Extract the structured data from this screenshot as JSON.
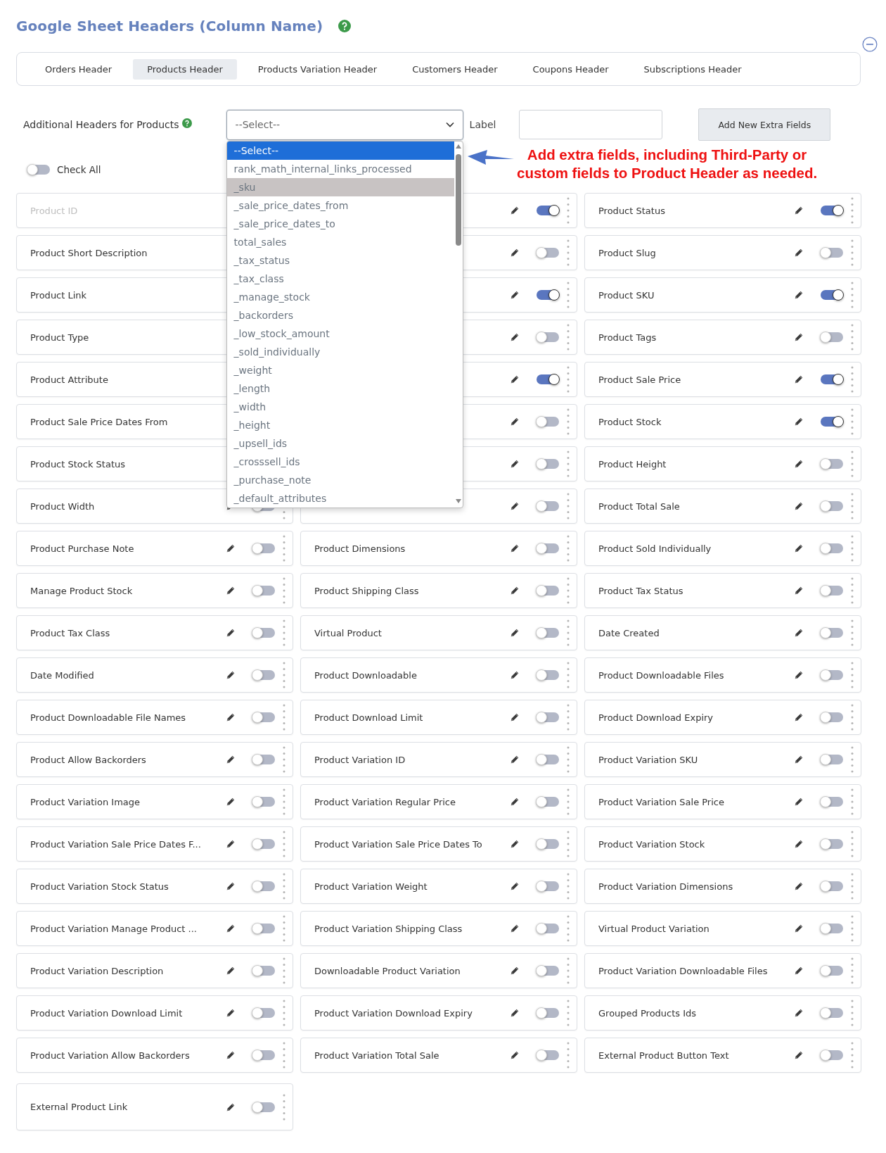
{
  "title": "Google Sheet Headers (Column Name)",
  "tabs": [
    {
      "label": "Orders Header",
      "selected": false
    },
    {
      "label": "Products Header",
      "selected": true
    },
    {
      "label": "Products Variation Header",
      "selected": false
    },
    {
      "label": "Customers Header",
      "selected": false
    },
    {
      "label": "Coupons Header",
      "selected": false
    },
    {
      "label": "Subscriptions Header",
      "selected": false
    }
  ],
  "extra": {
    "label": "Additional Headers for Products",
    "select": {
      "value": "--Select--",
      "expanded": true
    },
    "options": [
      {
        "label": "--Select--",
        "selected": true,
        "hovered": false
      },
      {
        "label": "rank_math_internal_links_processed",
        "selected": false,
        "hovered": false
      },
      {
        "label": "_sku",
        "selected": false,
        "hovered": true
      },
      {
        "label": "_sale_price_dates_from",
        "selected": false,
        "hovered": false
      },
      {
        "label": "_sale_price_dates_to",
        "selected": false,
        "hovered": false
      },
      {
        "label": "total_sales",
        "selected": false,
        "hovered": false
      },
      {
        "label": "_tax_status",
        "selected": false,
        "hovered": false
      },
      {
        "label": "_tax_class",
        "selected": false,
        "hovered": false
      },
      {
        "label": "_manage_stock",
        "selected": false,
        "hovered": false
      },
      {
        "label": "_backorders",
        "selected": false,
        "hovered": false
      },
      {
        "label": "_low_stock_amount",
        "selected": false,
        "hovered": false
      },
      {
        "label": "_sold_individually",
        "selected": false,
        "hovered": false
      },
      {
        "label": "_weight",
        "selected": false,
        "hovered": false
      },
      {
        "label": "_length",
        "selected": false,
        "hovered": false
      },
      {
        "label": "_width",
        "selected": false,
        "hovered": false
      },
      {
        "label": "_height",
        "selected": false,
        "hovered": false
      },
      {
        "label": "_upsell_ids",
        "selected": false,
        "hovered": false
      },
      {
        "label": "_crosssell_ids",
        "selected": false,
        "hovered": false
      },
      {
        "label": "_purchase_note",
        "selected": false,
        "hovered": false
      },
      {
        "label": "_default_attributes",
        "selected": false,
        "hovered": false
      }
    ],
    "field_label": "Label",
    "button": "Add New Extra Fields"
  },
  "annotation": [
    "Add extra fields, including Third-Party or",
    "custom fields to Product Header as needed."
  ],
  "check_all": {
    "label": "Check All",
    "on": false
  },
  "fields": [
    {
      "label": "Product ID",
      "disabled": true
    },
    {
      "on": true
    },
    {
      "label": "Product Status",
      "on": true,
      "disabled": false
    },
    {
      "label": "Product Short Description",
      "disabled": false
    },
    {
      "on": false
    },
    {
      "label": "Product Slug",
      "on": false,
      "disabled": false
    },
    {
      "label": "Product Link",
      "disabled": false
    },
    {
      "on": true
    },
    {
      "label": "Product SKU",
      "on": true,
      "disabled": false
    },
    {
      "label": "Product Type",
      "disabled": false
    },
    {
      "on": false
    },
    {
      "label": "Product Tags",
      "on": false,
      "disabled": false
    },
    {
      "label": "Product Attribute",
      "disabled": false
    },
    {
      "on": true
    },
    {
      "label": "Product Sale Price",
      "on": true,
      "disabled": false
    },
    {
      "label": "Product Sale Price Dates From",
      "disabled": false
    },
    {
      "on": false
    },
    {
      "label": "Product Stock",
      "on": true,
      "disabled": false
    },
    {
      "label": "Product Stock Status",
      "disabled": false
    },
    {
      "on": false
    },
    {
      "label": "Product Height",
      "on": false,
      "disabled": false
    },
    {
      "label": "Product Width",
      "on": false,
      "disabled": false
    },
    {
      "on": false
    },
    {
      "label": "Product Total Sale",
      "on": false,
      "disabled": false
    },
    {
      "label": "Product Purchase Note",
      "on": false,
      "disabled": false
    },
    {
      "label": "Product Dimensions",
      "on": false,
      "disabled": false
    },
    {
      "label": "Product Sold Individually",
      "on": false,
      "disabled": false
    },
    {
      "label": "Manage Product Stock",
      "on": false,
      "disabled": false
    },
    {
      "label": "Product Shipping Class",
      "on": false,
      "disabled": false
    },
    {
      "label": "Product Tax Status",
      "on": false,
      "disabled": false
    },
    {
      "label": "Product Tax Class",
      "on": false,
      "disabled": false
    },
    {
      "label": "Virtual Product",
      "on": false,
      "disabled": false
    },
    {
      "label": "Date Created",
      "on": false,
      "disabled": false
    },
    {
      "label": "Date Modified",
      "on": false,
      "disabled": false
    },
    {
      "label": "Product Downloadable",
      "on": false,
      "disabled": false
    },
    {
      "label": "Product Downloadable Files",
      "on": false,
      "disabled": false
    },
    {
      "label": "Product Downloadable File Names",
      "on": false,
      "disabled": false
    },
    {
      "label": "Product Download Limit",
      "on": false,
      "disabled": false
    },
    {
      "label": "Product Download Expiry",
      "on": false,
      "disabled": false
    },
    {
      "label": "Product Allow Backorders",
      "on": false,
      "disabled": false
    },
    {
      "label": "Product Variation ID",
      "on": false,
      "disabled": false
    },
    {
      "label": "Product Variation SKU",
      "on": false,
      "disabled": false
    },
    {
      "label": "Product Variation Image",
      "on": false,
      "disabled": false
    },
    {
      "label": "Product Variation Regular Price",
      "on": false,
      "disabled": false
    },
    {
      "label": "Product Variation Sale Price",
      "on": false,
      "disabled": false
    },
    {
      "label": "Product Variation Sale Price Dates F...",
      "on": false,
      "disabled": false
    },
    {
      "label": "Product Variation Sale Price Dates To",
      "on": false,
      "disabled": false
    },
    {
      "label": "Product Variation Stock",
      "on": false,
      "disabled": false
    },
    {
      "label": "Product Variation Stock Status",
      "on": false,
      "disabled": false
    },
    {
      "label": "Product Variation Weight",
      "on": false,
      "disabled": false
    },
    {
      "label": "Product Variation Dimensions",
      "on": false,
      "disabled": false
    },
    {
      "label": "Product Variation Manage Product ...",
      "on": false,
      "disabled": false
    },
    {
      "label": "Product Variation Shipping Class",
      "on": false,
      "disabled": false
    },
    {
      "label": "Virtual Product Variation",
      "on": false,
      "disabled": false
    },
    {
      "label": "Product Variation Description",
      "on": false,
      "disabled": false
    },
    {
      "label": "Downloadable Product Variation",
      "on": false,
      "disabled": false
    },
    {
      "label": "Product Variation Downloadable Files",
      "on": false,
      "disabled": false
    },
    {
      "label": "Product Variation Download Limit",
      "on": false,
      "disabled": false
    },
    {
      "label": "Product Variation Download Expiry",
      "on": false,
      "disabled": false
    },
    {
      "label": "Grouped Products Ids",
      "on": false,
      "disabled": false
    },
    {
      "label": "Product Variation Allow Backorders",
      "on": false,
      "disabled": false
    },
    {
      "label": "Product Variation Total Sale",
      "on": false,
      "disabled": false
    },
    {
      "label": "External Product Button Text",
      "on": false,
      "disabled": false
    },
    {
      "label": "External Product Link",
      "on": false,
      "disabled": false
    }
  ]
}
